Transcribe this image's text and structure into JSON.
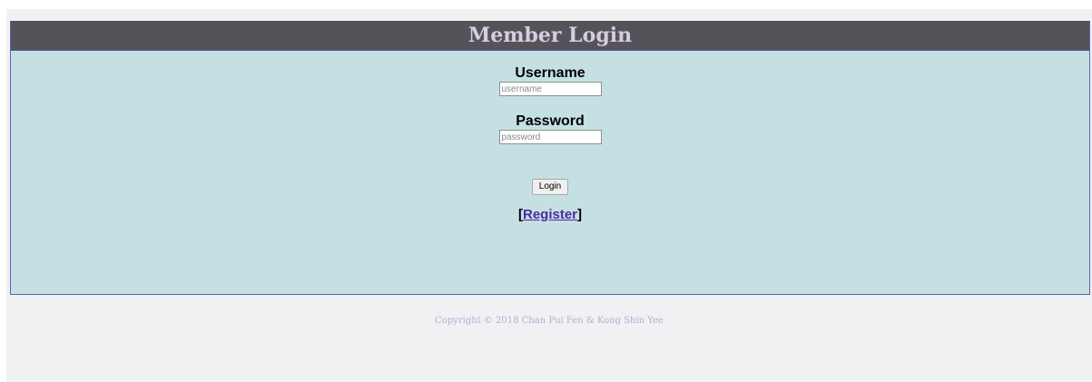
{
  "header": {
    "title": "Member Login"
  },
  "form": {
    "username_label": "Username",
    "username_placeholder": "username",
    "password_label": "Password",
    "password_placeholder": "password",
    "login_button": "Login",
    "register_open": "[",
    "register_link": "Register",
    "register_close": "]"
  },
  "footer": {
    "copyright": "Copyright © 2018 Chan Pui Fen & Kong Shin Yee"
  },
  "colors": {
    "header_bg": "#55535a",
    "header_text": "#d7cce0",
    "panel_bg": "#c5e0e2",
    "panel_border": "#5a64b4",
    "page_bg": "#f0f1f3",
    "link": "#4f2aa0",
    "copyright_text": "#b3aed0"
  }
}
